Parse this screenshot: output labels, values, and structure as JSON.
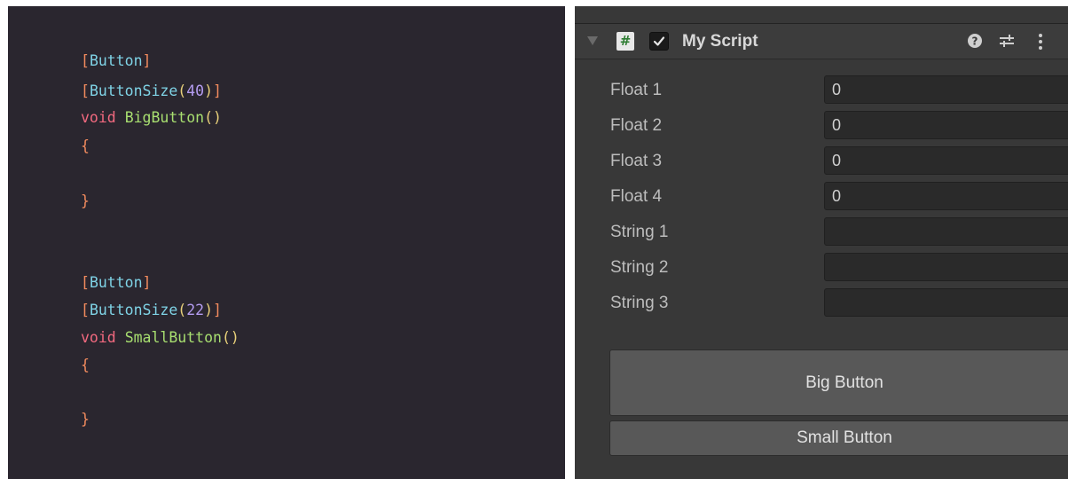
{
  "code": {
    "lines": [
      {
        "open": "[",
        "attr": "Button",
        "close": "]"
      },
      {
        "open": "[",
        "attr": "ButtonSize",
        "arg": "40",
        "close": "]"
      },
      {
        "kw": "void",
        "fn": "BigButton"
      },
      {
        "brace": "{"
      },
      {
        "brace": "}"
      },
      {
        "open": "[",
        "attr": "Button",
        "close": "]"
      },
      {
        "open": "[",
        "attr": "ButtonSize",
        "arg": "22",
        "close": "]"
      },
      {
        "kw": "void",
        "fn": "SmallButton"
      },
      {
        "brace": "{"
      },
      {
        "brace": "}"
      }
    ],
    "paren_open": "(",
    "paren_close": ")",
    "empty_parens": "()"
  },
  "inspector": {
    "component": {
      "title": "My Script",
      "script_icon_glyph": "#",
      "enabled": true,
      "icons": [
        "help-icon",
        "preset-icon",
        "more-menu-icon"
      ]
    },
    "properties": [
      {
        "label": "Float 1",
        "value": "0"
      },
      {
        "label": "Float 2",
        "value": "0"
      },
      {
        "label": "Float 3",
        "value": "0"
      },
      {
        "label": "Float 4",
        "value": "0"
      },
      {
        "label": "String 1",
        "value": ""
      },
      {
        "label": "String 2",
        "value": ""
      },
      {
        "label": "String 3",
        "value": ""
      }
    ],
    "buttons": {
      "big": "Big Button",
      "small": "Small Button"
    }
  },
  "colors": {
    "code_background": "#2a262f",
    "inspector_background": "#383838",
    "button_background": "#585858"
  }
}
